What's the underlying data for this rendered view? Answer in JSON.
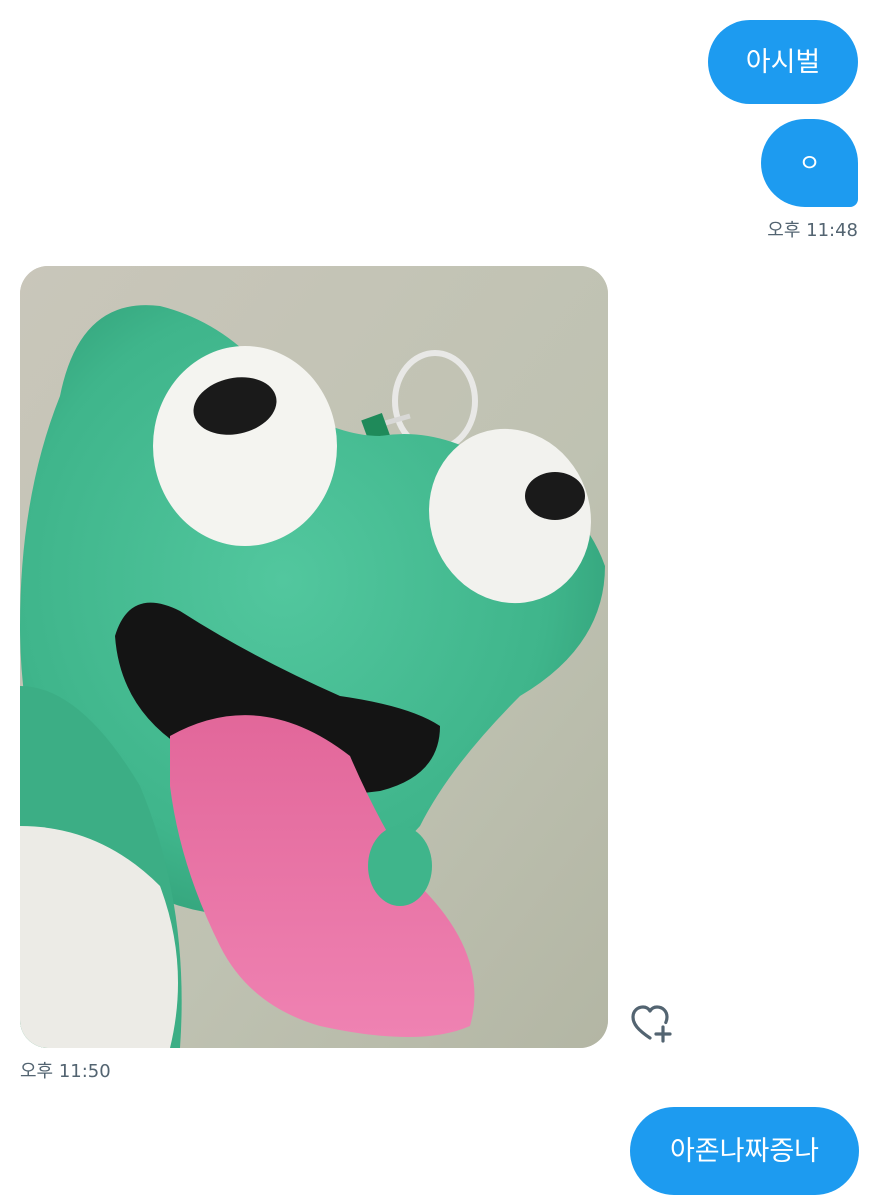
{
  "messages": [
    {
      "side": "sent",
      "text": "아시벌"
    },
    {
      "side": "sent",
      "text": "ㅇ",
      "time": "오후 11:48"
    },
    {
      "side": "received",
      "type": "image",
      "image_alt": "green plush frog keychain with pink tongue",
      "time": "오후 11:50"
    },
    {
      "side": "sent",
      "text": "아존나짜증나"
    }
  ],
  "icons": {
    "reaction": "heart-plus-icon"
  },
  "colors": {
    "bubble": "#1d9bf0",
    "timestamp": "#536471",
    "icon": "#536471"
  }
}
